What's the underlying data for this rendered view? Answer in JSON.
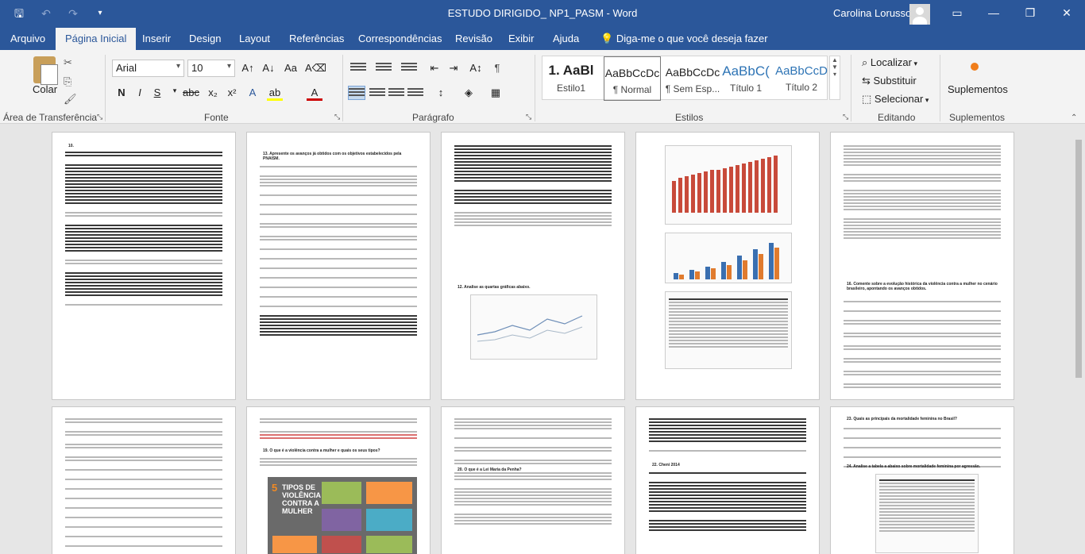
{
  "window": {
    "title": "ESTUDO DIRIGIDO_ NP1_PASM  -  Word",
    "user": "Carolina Lorusso"
  },
  "tabs": [
    "Arquivo",
    "Página Inicial",
    "Inserir",
    "Design",
    "Layout",
    "Referências",
    "Correspondências",
    "Revisão",
    "Exibir",
    "Ajuda"
  ],
  "tell_me": "Diga-me o que você deseja fazer",
  "clipboard": {
    "paste_label": "Colar",
    "group": "Área de Transferência"
  },
  "font": {
    "name": "Arial",
    "size": "10",
    "group": "Fonte"
  },
  "paragraph": {
    "group": "Parágrafo"
  },
  "styles": {
    "group": "Estilos",
    "items": [
      {
        "sample": "1. AaBl",
        "name": "Estilo1"
      },
      {
        "sample": "AaBbCcDc",
        "name": "¶ Normal"
      },
      {
        "sample": "AaBbCcDc",
        "name": "¶ Sem Esp..."
      },
      {
        "sample": "AaBbC(",
        "name": "Título 1"
      },
      {
        "sample": "AaBbCcD",
        "name": "Título 2"
      }
    ]
  },
  "editing": {
    "group": "Editando",
    "find": "Localizar",
    "replace": "Substituir",
    "select": "Selecionar"
  },
  "addins": {
    "label": "Suplementos",
    "group": "Suplementos"
  },
  "pages": {
    "p1_heading": "10.",
    "p2_heading": "13. Apresente os avanços já obtidos com os objetivos estabelecidos pela PNAISM.",
    "p3_q": "12. Analise as quartas gráficas abaixo.",
    "p5_q": "16. Comente sobre a evolução histórica da violência contra a mulher no cenário brasileiro, apontando os avanços obtidos.",
    "p7_q": "19. O que é a violência contra a mulher e quais os seus tipos?",
    "p7_poster_num": "5",
    "p7_poster_title": "TIPOS DE VIOLÊNCIA CONTRA A MULHER",
    "p8_q": "20. O que é a Lei Maria da Penha?",
    "p9_q": "22. Cheni 2014",
    "p10_q": "23. Quais as principais da mortalidade feminina no Brasil?",
    "p10_q2": "24. Analise a tabela a abaixo sobre mortalidade feminina por agressão."
  }
}
